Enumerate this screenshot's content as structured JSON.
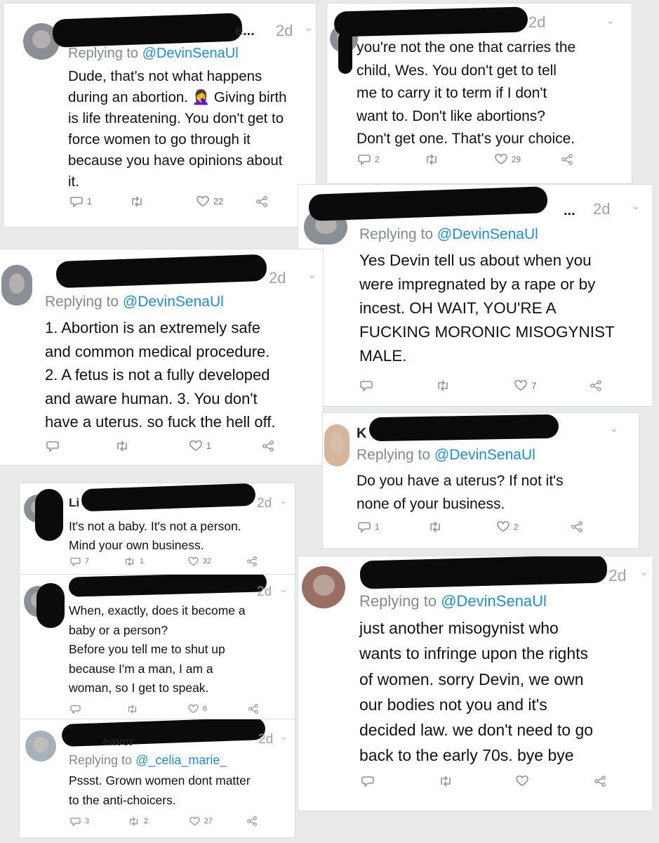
{
  "reply_prefix": "Replying to",
  "tweets": [
    {
      "name_visible": "e...",
      "time": "2d",
      "reply_to": "@DevinSenaUl",
      "lines": [
        "Dude, that's not what happens",
        "during an abortion. 🤦‍♀️ Giving birth",
        "is life threatening. You don't get to",
        "force women to go through it",
        "because you have opinions about",
        "it."
      ],
      "counts": {
        "reply": "1",
        "retweet": "",
        "like": "22"
      }
    },
    {
      "name_visible": "",
      "time": "2d",
      "reply_to": "",
      "lines": [
        "you're not the one that carries the",
        "child, Wes.  You don't get to tell",
        "me to carry it to term if I don't",
        "want to. Don't like abortions?",
        "Don't get one.  That's your choice."
      ],
      "counts": {
        "reply": "2",
        "retweet": "",
        "like": "29"
      }
    },
    {
      "name_visible": "...",
      "time": "2d",
      "reply_to": "@DevinSenaUl",
      "lines": [
        "Yes Devin tell us about when you",
        "were impregnated by a rape or by",
        "incest. OH WAIT, YOU'RE A",
        "FUCKING MORONIC MISOGYNIST",
        "MALE."
      ],
      "counts": {
        "reply": "",
        "retweet": "",
        "like": "7"
      }
    },
    {
      "name_visible": "",
      "time": "2d",
      "reply_to": "@DevinSenaUl",
      "lines": [
        "1. Abortion is an extremely safe",
        "and common medical procedure.",
        "2. A fetus is not a fully developed",
        "and aware human. 3. You don't",
        "have a uterus. so fuck the hell off."
      ],
      "counts": {
        "reply": "",
        "retweet": "",
        "like": "1"
      }
    },
    {
      "name_visible": "K",
      "time": "",
      "reply_to": "@DevinSenaUl",
      "lines": [
        "Do you have a uterus?   If not it's",
        "none of your business."
      ],
      "counts": {
        "reply": "1",
        "retweet": "",
        "like": "2"
      }
    },
    {
      "name_visible": "Li",
      "time": "2d",
      "reply_to": "",
      "lines": [
        "It's not a baby. It's not a person.",
        "Mind your own business."
      ],
      "counts": {
        "reply": "7",
        "retweet": "1",
        "like": "32"
      }
    },
    {
      "name_visible": "",
      "time": "2d",
      "reply_to": "@DevinSenaUl",
      "lines": [
        "just another misogynist who",
        "wants to infringe upon the rights",
        "of women.  sorry Devin, we own",
        "our bodies not you and it's",
        "decided law. we don't need to go",
        "back to the early 70s.  bye bye"
      ],
      "counts": {
        "reply": "",
        "retweet": "",
        "like": ""
      }
    },
    {
      "name_visible": "",
      "time": "2d",
      "reply_to": "",
      "lines": [
        "When, exactly, does it become a",
        "baby or a person?",
        "Before you tell me to shut up",
        "because I'm a man, I am a",
        "woman, so I get to speak."
      ],
      "counts": {
        "reply": "",
        "retweet": "",
        "like": "6"
      }
    },
    {
      "name_visible": "eaver",
      "time": "2d",
      "reply_to": "@_celia_marie_",
      "lines": [
        "Pssst. Grown women dont matter",
        "to the anti-choicers."
      ],
      "counts": {
        "reply": "3",
        "retweet": "2",
        "like": "27"
      }
    }
  ]
}
